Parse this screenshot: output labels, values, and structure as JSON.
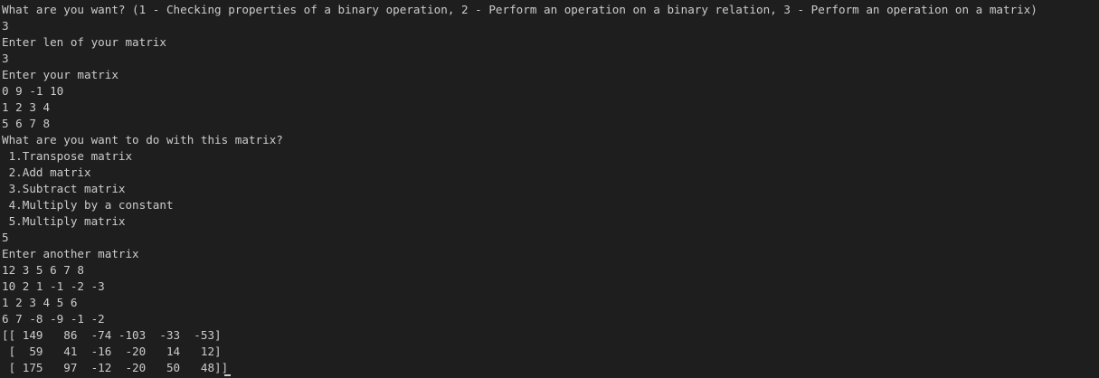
{
  "terminal": {
    "lines": [
      "What are you want? (1 - Checking properties of a binary operation, 2 - Perform an operation on a binary relation, 3 - Perform an operation on a matrix)",
      "3",
      "Enter len of your matrix",
      "3",
      "Enter your matrix",
      "0 9 -1 10",
      "1 2 3 4",
      "5 6 7 8",
      "What are you want to do with this matrix?",
      " 1.Transpose matrix",
      " 2.Add matrix",
      " 3.Subtract matrix",
      " 4.Multiply by a constant",
      " 5.Multiply matrix",
      "5",
      "Enter another matrix",
      "12 3 5 6 7 8",
      "10 2 1 -1 -2 -3",
      "1 2 3 4 5 6",
      "6 7 -8 -9 -1 -2",
      "[[ 149   86  -74 -103  -33  -53]",
      " [  59   41  -16  -20   14   12]"
    ],
    "last_line": " [ 175   97  -12  -20   50   48]]"
  }
}
